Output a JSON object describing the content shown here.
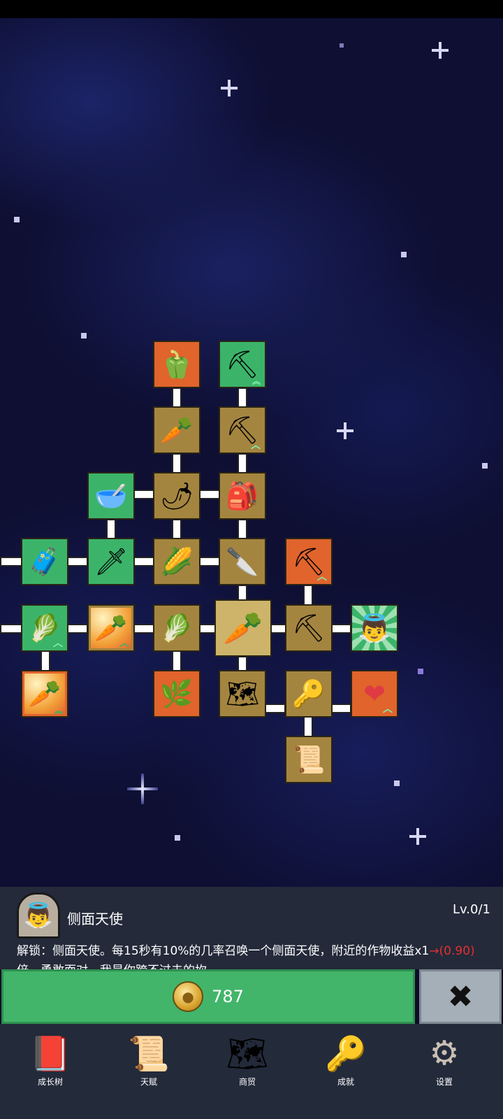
{
  "skill_panel": {
    "name": "侧面天使",
    "level": "Lv.0/1",
    "desc_main": "解锁：侧面天使。每15秒有10%的几率召唤一个侧面天使，附近的作物收益x1",
    "desc_red": "→(0.90)",
    "desc_end": "倍。勇敢面对，我是你跨不过去的坎。"
  },
  "buy_button": {
    "cost": "787",
    "coin_icon": "coin-icon"
  },
  "close_button": {
    "icon": "close-icon",
    "symbol": "✖"
  },
  "nav": [
    {
      "label": "成长树",
      "icon": "book-icon",
      "glyph": "📕"
    },
    {
      "label": "天赋",
      "icon": "scroll-icon",
      "glyph": "📜"
    },
    {
      "label": "商贸",
      "icon": "map-icon",
      "glyph": "🗺"
    },
    {
      "label": "成就",
      "icon": "key-icon",
      "glyph": "🔑"
    },
    {
      "label": "设置",
      "icon": "gear-icon",
      "glyph": "⚙"
    }
  ],
  "colors": {
    "gold_tile": "#a48540",
    "orange_tile": "#e0642c",
    "green_tile": "#3bb46a",
    "buy_green": "#42b56a",
    "close_grey": "#a5afb8",
    "panel_bg": "#242a3a"
  },
  "tree_tiles": [
    {
      "id": "pepper",
      "icon": "pepper-icon",
      "glyph": "🫑",
      "style": "orange"
    },
    {
      "id": "shovel-double-up",
      "icon": "shovel-icon",
      "glyph": "⛏",
      "style": "green",
      "badge": "double-up"
    },
    {
      "id": "radish",
      "icon": "radish-icon",
      "glyph": "🥕",
      "style": "gold"
    },
    {
      "id": "shovel-up",
      "icon": "shovel-icon",
      "glyph": "⛏",
      "style": "gold",
      "badge": "up"
    },
    {
      "id": "bowl",
      "icon": "bowl-icon",
      "glyph": "🥣",
      "style": "green"
    },
    {
      "id": "chili",
      "icon": "chili-icon",
      "glyph": "🌶",
      "style": "gold"
    },
    {
      "id": "backpack",
      "icon": "backpack-icon",
      "glyph": "🎒",
      "style": "gold"
    },
    {
      "id": "chest",
      "icon": "chest-icon",
      "glyph": "🧳",
      "style": "green"
    },
    {
      "id": "sword",
      "icon": "sword-icon",
      "glyph": "🗡",
      "style": "green"
    },
    {
      "id": "corn",
      "icon": "corn-icon",
      "glyph": "🌽",
      "style": "gold"
    },
    {
      "id": "knife",
      "icon": "knife-icon",
      "glyph": "🔪",
      "style": "gold"
    },
    {
      "id": "pickaxe-up",
      "icon": "pickaxe-icon",
      "glyph": "⛏",
      "style": "orange",
      "badge": "up"
    },
    {
      "id": "cabbage-up",
      "icon": "cabbage-icon",
      "glyph": "🥬",
      "style": "green",
      "badge": "up"
    },
    {
      "id": "carrot-glow",
      "icon": "carrot-icon",
      "glyph": "🥕",
      "style": "glow",
      "badge": "up"
    },
    {
      "id": "cabbage",
      "icon": "cabbage-icon",
      "glyph": "🥬",
      "style": "gold"
    },
    {
      "id": "carrot-selected",
      "icon": "carrot-icon",
      "glyph": "🥕",
      "style": "selected"
    },
    {
      "id": "pickaxe",
      "icon": "pickaxe-icon",
      "glyph": "⛏",
      "style": "gold"
    },
    {
      "id": "angel",
      "icon": "angel-icon",
      "glyph": "👼",
      "style": "rays"
    },
    {
      "id": "carrot-double-up",
      "icon": "carrot-icon",
      "glyph": "🥕",
      "style": "glow-orange",
      "badge": "double-up"
    },
    {
      "id": "parsnip",
      "icon": "parsnip-icon",
      "glyph": "🌿",
      "style": "orange"
    },
    {
      "id": "map",
      "icon": "map-icon",
      "glyph": "🗺",
      "style": "gold"
    },
    {
      "id": "key",
      "icon": "key-icon",
      "glyph": "🔑",
      "style": "gold"
    },
    {
      "id": "heart-up",
      "icon": "heart-icon",
      "glyph": "❤",
      "style": "orange",
      "badge": "up"
    },
    {
      "id": "scroll",
      "icon": "scroll-icon",
      "glyph": "📜",
      "style": "gold"
    }
  ]
}
